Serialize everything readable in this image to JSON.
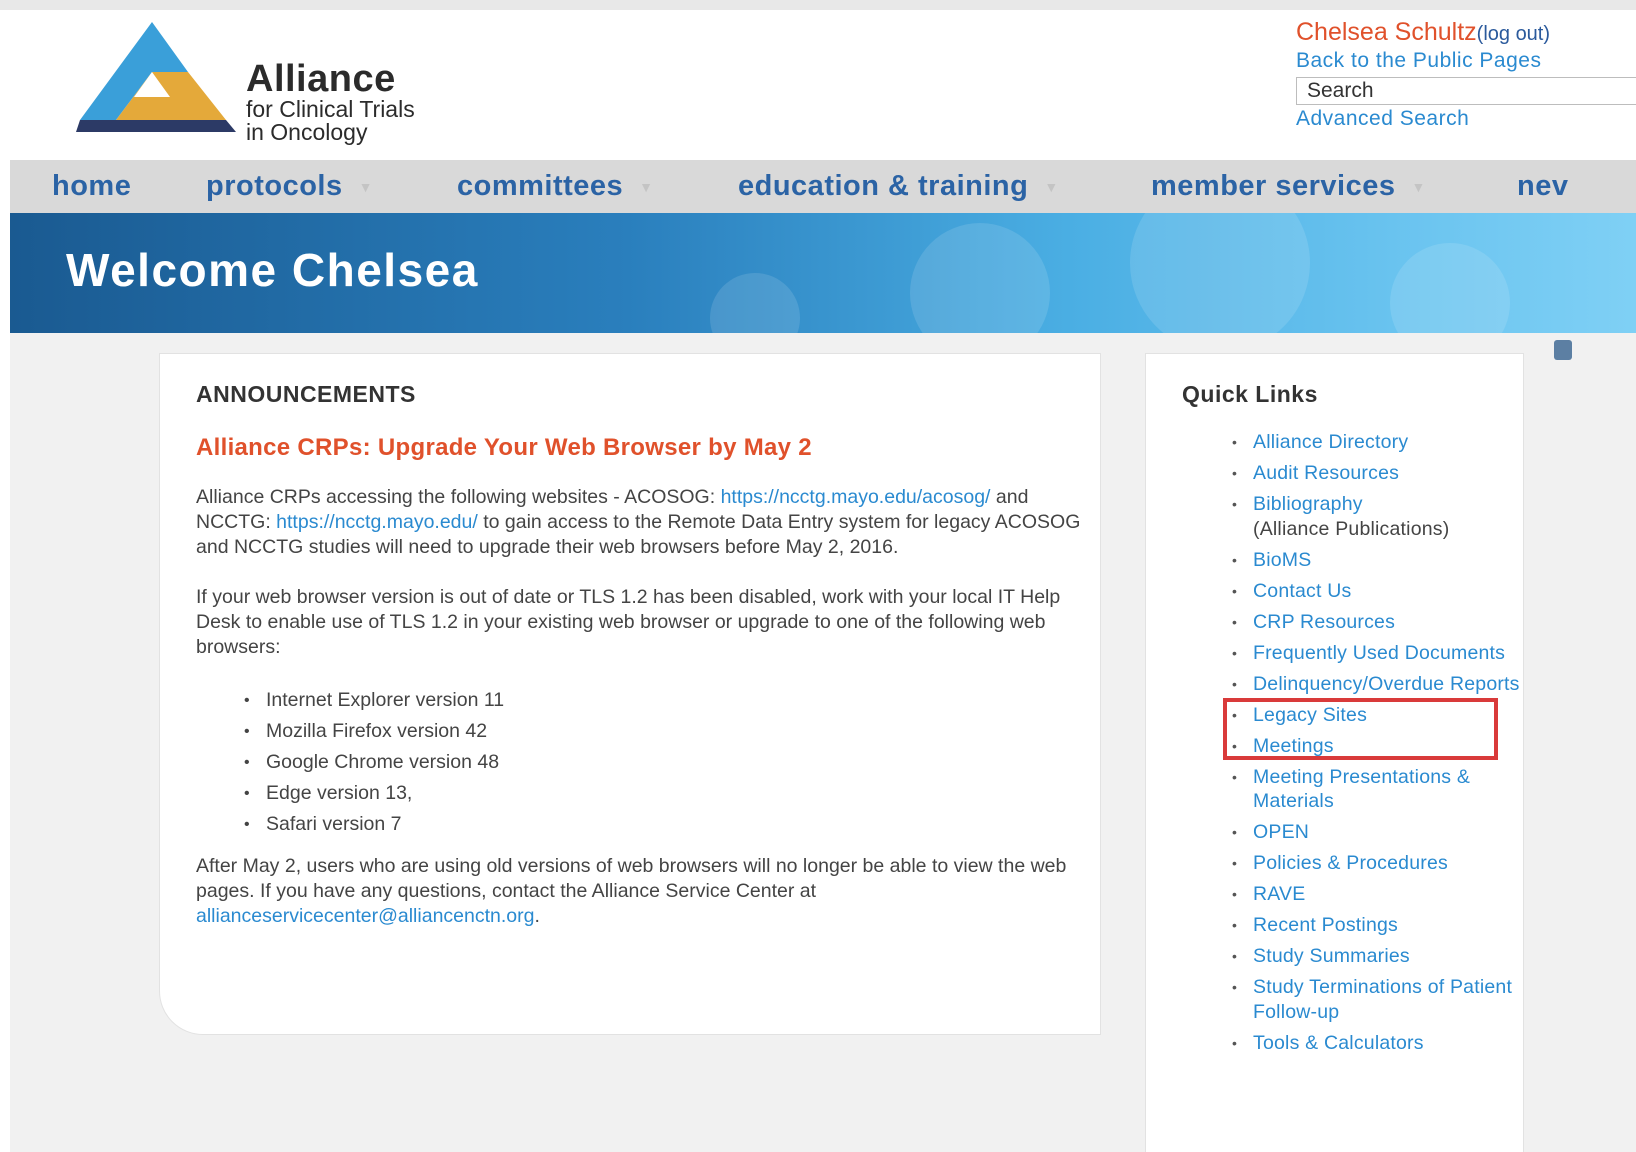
{
  "header": {
    "logo": {
      "main": "Alliance",
      "sub1": "for Clinical Trials",
      "sub2": "in Oncology",
      "colors": [
        "#3a9fd9",
        "#e4a93a",
        "#2c3a66"
      ]
    },
    "user": {
      "name": "Chelsea Schultz",
      "logout": "(log out)",
      "public_link": "Back to the Public Pages",
      "search_placeholder": "Search",
      "advanced_search": "Advanced Search"
    }
  },
  "nav": {
    "items": [
      {
        "label": "home",
        "has_caret": false
      },
      {
        "label": "protocols",
        "has_caret": true
      },
      {
        "label": "committees",
        "has_caret": true
      },
      {
        "label": "education & training",
        "has_caret": true
      },
      {
        "label": "member services",
        "has_caret": true
      },
      {
        "label": "nev",
        "has_caret": false
      }
    ]
  },
  "banner": {
    "title": "Welcome Chelsea"
  },
  "announcements": {
    "heading": "ANNOUNCEMENTS",
    "title": "Alliance CRPs: Upgrade Your Web Browser by May 2",
    "para1": {
      "t1": "Alliance CRPs accessing the following websites - ACOSOG:",
      "link1": "https://ncctg.mayo.edu/acosog/",
      "t2": " and NCCTG: ",
      "link2": "https://ncctg.mayo.edu/",
      "t3": " to gain access to the Remote Data Entry system for legacy ACOSOG and NCCTG studies will need to upgrade their web browsers before May 2, 2016."
    },
    "para2": "If your web browser version is out of date or TLS 1.2 has been disabled, work with your local IT Help Desk to enable use of TLS 1.2 in your existing web browser or upgrade to one of the following web browsers:",
    "browsers": [
      "Internet Explorer version 11",
      "Mozilla Firefox version 42",
      "Google Chrome version 48",
      "Edge version 13,",
      "Safari version 7"
    ],
    "para3": {
      "t1": "After May 2, users who are using old versions of web browsers will no longer be able to view the web pages. If you have any questions, contact the Alliance Service Center at ",
      "email": "allianceservicecenter@alliancenctn.org",
      "t2": "."
    }
  },
  "quick_links": {
    "heading": "Quick Links",
    "items": [
      {
        "label": "Alliance Directory"
      },
      {
        "label": "Audit Resources"
      },
      {
        "label": "Bibliography",
        "note": "(Alliance Publications)"
      },
      {
        "label": "BioMS"
      },
      {
        "label": "Contact Us"
      },
      {
        "label": "CRP Resources"
      },
      {
        "label": "Frequently Used Documents"
      },
      {
        "label": "Delinquency/Overdue Reports"
      },
      {
        "label": "Legacy Sites"
      },
      {
        "label": "Meetings"
      },
      {
        "label": "Meeting Presentations & Materials"
      },
      {
        "label": "OPEN"
      },
      {
        "label": "Policies & Procedures"
      },
      {
        "label": "RAVE"
      },
      {
        "label": "Recent Postings"
      },
      {
        "label": "Study Summaries"
      },
      {
        "label": "Study Terminations of Patient Follow-up"
      },
      {
        "label": "Tools & Calculators"
      }
    ],
    "highlight_color": "#d93a3a"
  }
}
